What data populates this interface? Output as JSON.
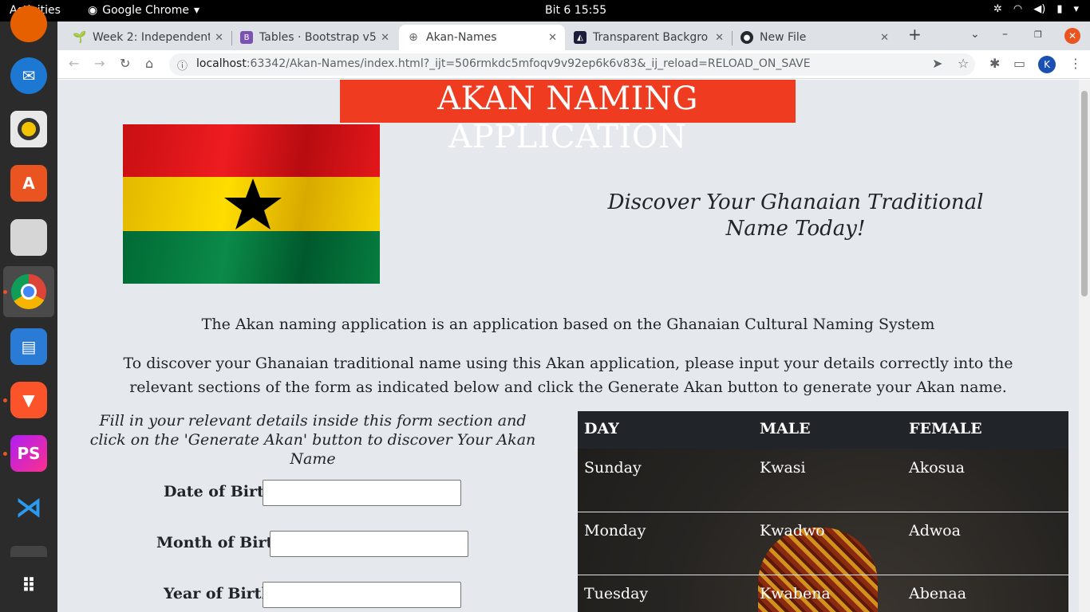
{
  "topbar": {
    "activities": "Activities",
    "app_name": "Google Chrome",
    "clock": "Bit 6  15:55"
  },
  "dock": {
    "apps": [
      "firefox",
      "thunderbird",
      "rhythmbox",
      "ubuntu-software",
      "files",
      "chrome",
      "libreoffice-writer",
      "brave",
      "phpstorm",
      "vscode",
      "terminal",
      "show-apps"
    ]
  },
  "tabs": [
    {
      "title": "Week 2: Independent",
      "icon": "seedling-icon"
    },
    {
      "title": "Tables · Bootstrap v5",
      "icon": "bootstrap-icon"
    },
    {
      "title": "Akan-Names",
      "icon": "globe-icon",
      "active": true
    },
    {
      "title": "Transparent Backgro",
      "icon": "layer-icon"
    },
    {
      "title": "New File",
      "icon": "github-icon"
    }
  ],
  "address": {
    "host": "localhost",
    "path": ":63342/Akan-Names/index.html?_ijt=506rmkdc5mfoqv9v92ep6k6v83&_ij_reload=RELOAD_ON_SAVE"
  },
  "profile_initial": "K",
  "page": {
    "title": "AKAN NAMING APPLICATION",
    "tagline": "Discover Your Ghanaian Traditional Name Today!",
    "intro1": "The Akan naming application is an application based on the Ghanaian Cultural Naming System",
    "intro2": "To discover your Ghanaian traditional name using this Akan application, please input your details correctly into the relevant sections of the form as indicated below and click the Generate Akan button to generate your Akan name.",
    "form_hint": "Fill in your relevant details inside this form section and click on the 'Generate Akan' button to discover Your Akan Name",
    "fields": {
      "dob_label": "Date of Birth:",
      "mob_label": "Month of Birth:",
      "yob_label": "Year of Birth:",
      "dob_value": "",
      "mob_value": "",
      "yob_value": ""
    },
    "table": {
      "headers": [
        "DAY",
        "MALE",
        "FEMALE"
      ],
      "rows": [
        [
          "Sunday",
          "Kwasi",
          "Akosua"
        ],
        [
          "Monday",
          "Kwadwo",
          "Adwoa"
        ],
        [
          "Tuesday",
          "Kwabena",
          "Abenaa"
        ]
      ]
    }
  },
  "colors": {
    "title_bg": "#ef3b1f",
    "page_bg": "#e5e9ed",
    "table_head": "#212529"
  }
}
